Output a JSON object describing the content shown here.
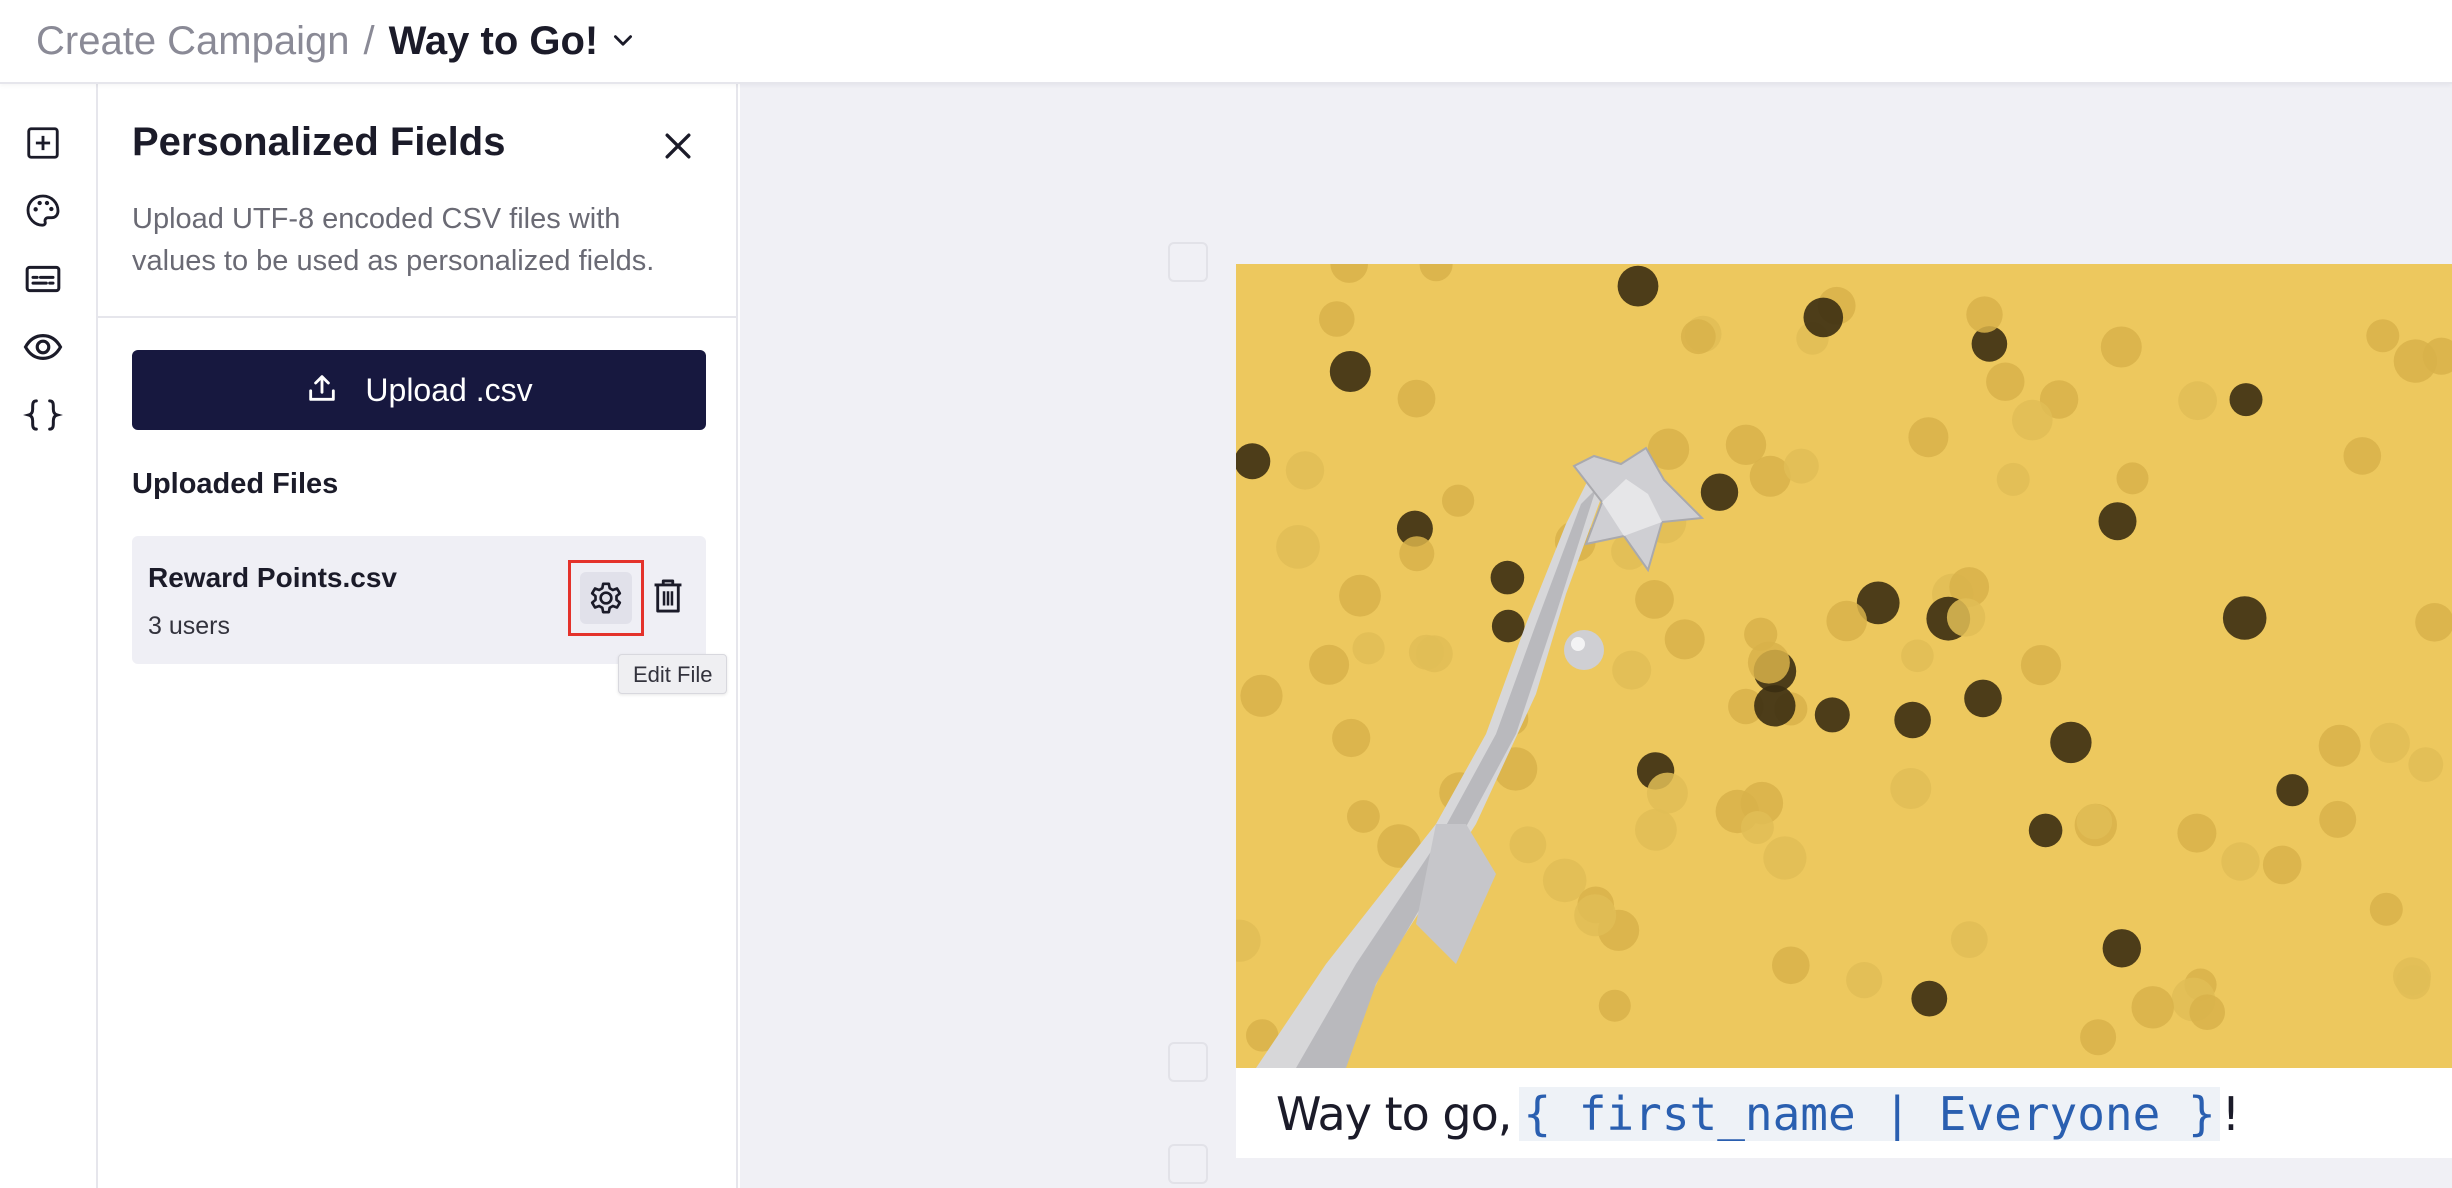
{
  "header": {
    "breadcrumb_parent": "Create Campaign",
    "separator": "/",
    "campaign_name": "Way to Go!"
  },
  "rail": {
    "items": [
      "add-icon",
      "palette-icon",
      "subtitles-icon",
      "preview-eye-icon",
      "braces-icon"
    ]
  },
  "panel": {
    "title": "Personalized Fields",
    "description": "Upload UTF-8 encoded CSV files with values to be used as personalized fields.",
    "upload_label": "Upload .csv",
    "files_heading": "Uploaded Files",
    "files": [
      {
        "name": "Reward Points.csv",
        "meta": "3 users"
      }
    ],
    "tooltip": "Edit File"
  },
  "canvas": {
    "caption_prefix": "Way to go,",
    "caption_token": "{ first_name | Everyone }",
    "caption_suffix": "!",
    "photo_alt": "silver star trophy on yellow background with gold confetti"
  },
  "colors": {
    "primary_button": "#17183f",
    "highlight_border": "#e4322b",
    "photo_background": "#edc85e",
    "token_text": "#2a5fb0"
  }
}
